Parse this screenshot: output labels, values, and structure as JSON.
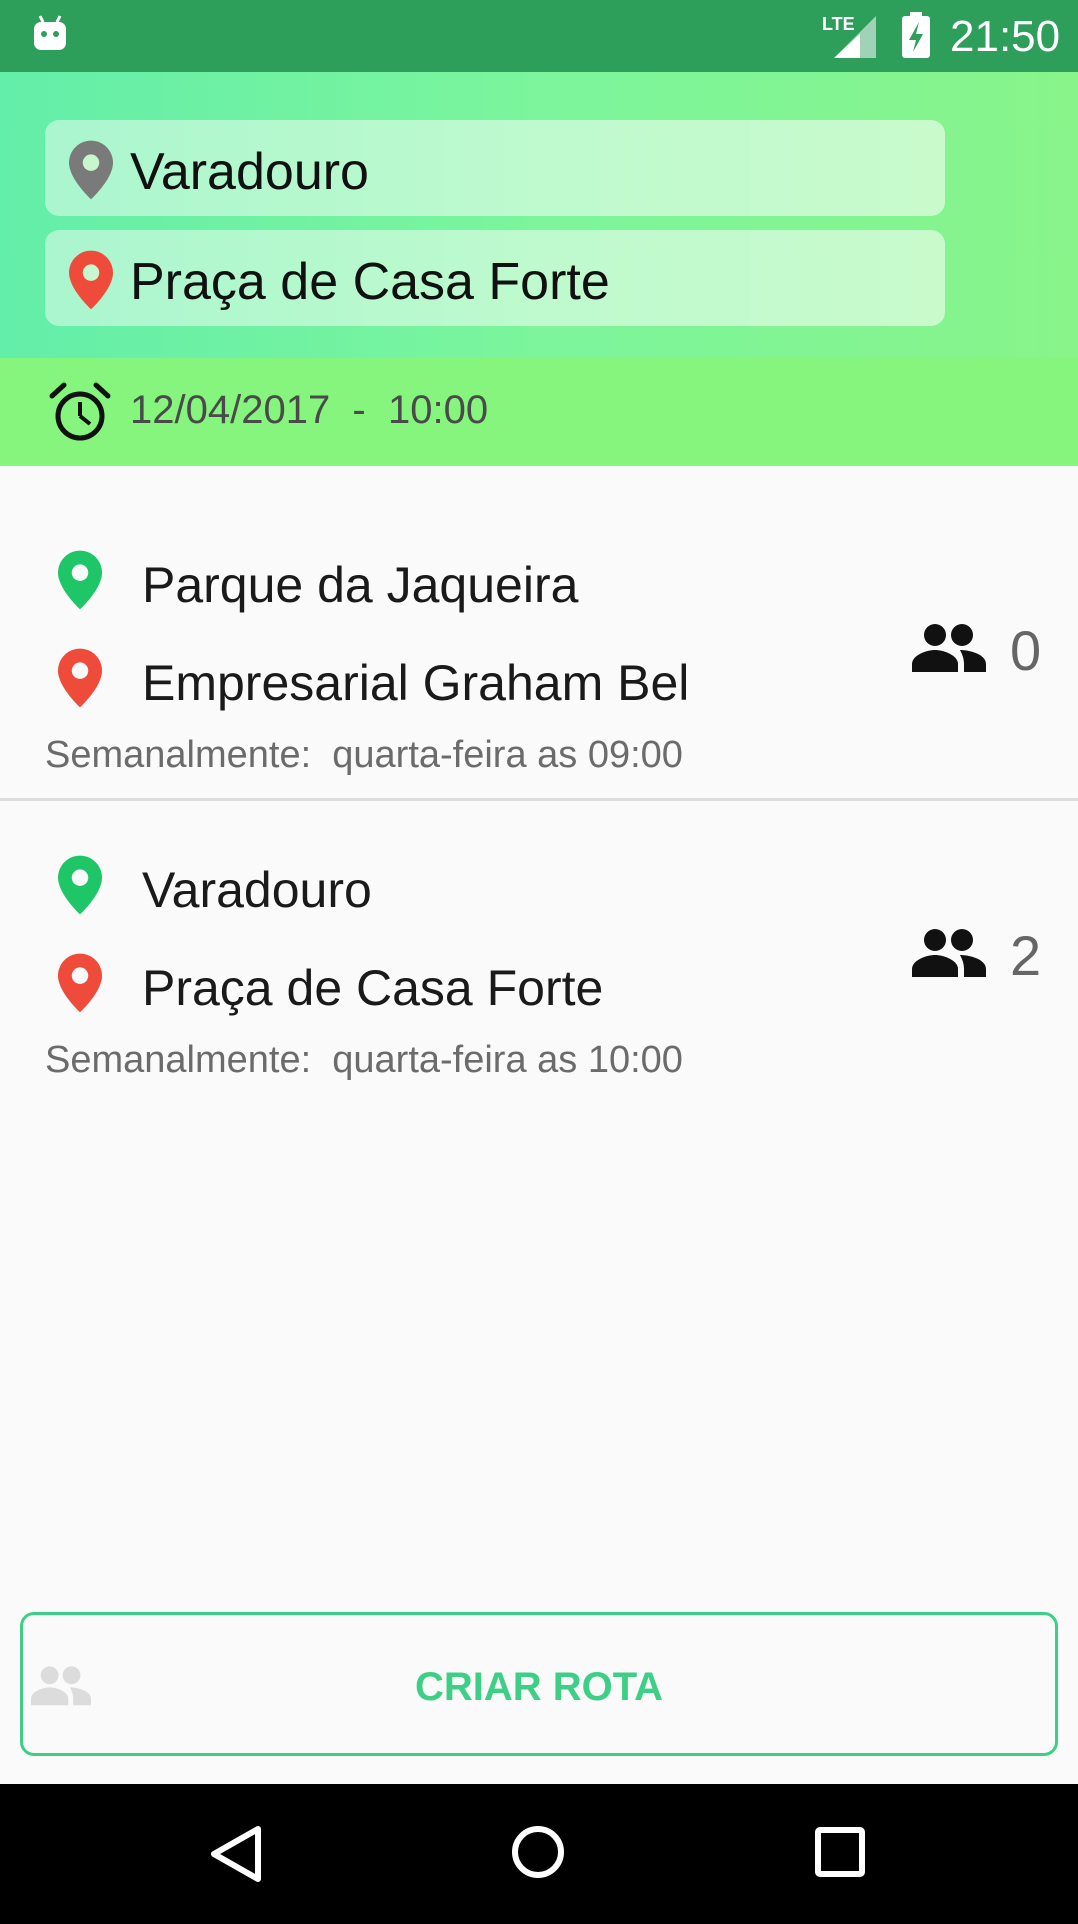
{
  "status_bar": {
    "time": "21:50",
    "network": "LTE",
    "icons": [
      "android-icon",
      "lte-signal-icon",
      "battery-charging-icon"
    ]
  },
  "search": {
    "origin": "Varadouro",
    "destination": "Praça de Casa Forte",
    "origin_icon": "gray-pin-icon",
    "destination_icon": "red-pin-icon"
  },
  "schedule": {
    "datetime": "12/04/2017  -  10:00",
    "icon": "alarm-icon"
  },
  "routes": [
    {
      "from": "Parque da Jaqueira",
      "to": "Empresarial Graham Bel",
      "frequency": "Semanalmente:  quarta-feira as 09:00",
      "passengers": "0"
    },
    {
      "from": "Varadouro",
      "to": "Praça de Casa Forte",
      "frequency": "Semanalmente:  quarta-feira as 10:00",
      "passengers": "2"
    }
  ],
  "actions": {
    "create_route": "CRIAR ROTA"
  },
  "colors": {
    "status_bar": "#2e9e5b",
    "header_start": "#63eea9",
    "header_end": "#88f48a",
    "date_bar": "#86f57d",
    "accent": "#3ecf86",
    "origin_pin": "#1ec668",
    "destination_pin": "#ee4b3b"
  },
  "nav_bar": {
    "icons": [
      "back-icon",
      "home-icon",
      "recent-apps-icon"
    ]
  }
}
